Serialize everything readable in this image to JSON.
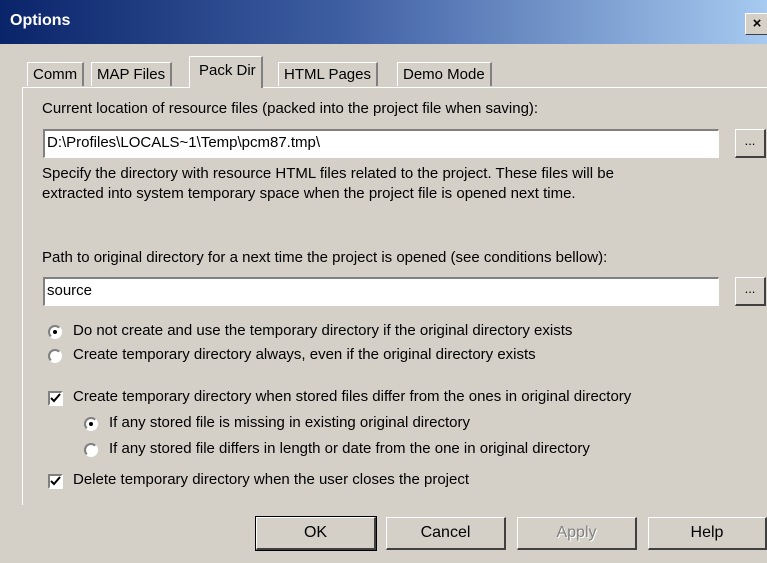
{
  "window": {
    "title": "Options",
    "close_glyph": "×"
  },
  "tabs": [
    {
      "label": "Comm"
    },
    {
      "label": "MAP Files"
    },
    {
      "label": "Pack Dir",
      "active": true
    },
    {
      "label": "HTML Pages"
    },
    {
      "label": "Demo Mode"
    }
  ],
  "pack_dir": {
    "current_location_label": "Current location of resource files (packed into the project file when saving):",
    "current_location_value": "D:\\Profiles\\LOCALS~1\\Temp\\pcm87.tmp\\",
    "browse_label": "...",
    "description_line1": "Specify the directory with resource HTML files related to the project. These files will be",
    "description_line2": "extracted into system temporary space when the project file is opened next time.",
    "original_path_label": "Path to original directory for a next time the project is opened (see conditions bellow):",
    "original_path_value": "source",
    "radio_no_temp": "Do not create and use the temporary directory if the original directory exists",
    "radio_always_temp": "Create temporary directory always, even if the original directory exists",
    "check_differ": "Create temporary directory when stored files differ from the ones in original directory",
    "sub_radio_missing": "If any stored file is missing in existing original directory",
    "sub_radio_differs": "If any stored file differs in length or date from the one in original directory",
    "check_delete": "Delete temporary directory when the user closes the project",
    "selected_radio": "no_temp",
    "selected_sub_radio": "missing",
    "check_differ_checked": true,
    "check_delete_checked": true
  },
  "buttons": {
    "ok": "OK",
    "cancel": "Cancel",
    "apply": "Apply",
    "help": "Help"
  }
}
